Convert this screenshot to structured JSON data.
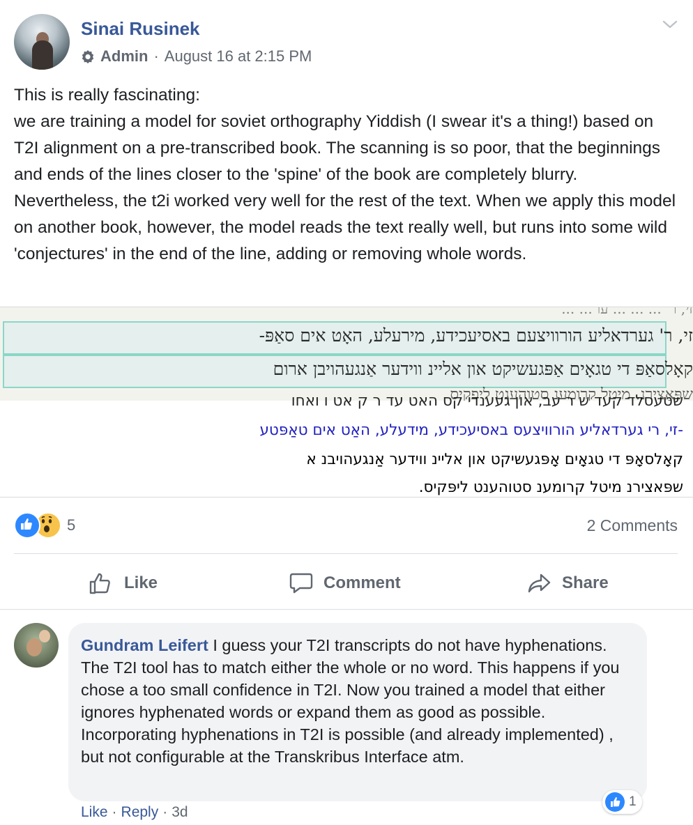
{
  "post": {
    "author": "Sinai Rusinek",
    "role": "Admin",
    "separator": "·",
    "timestamp": "August 16 at 2:15 PM",
    "text": "This is really fascinating:\nwe are training a model for soviet orthography Yiddish (I swear it's a thing!) based on T2I alignment on a pre-transcribed book. The scanning is so poor, that the beginnings and ends of the lines closer to the 'spine' of the book are completely blurry. Nevertheless, the t2i worked very well for the rest of the text. When we apply this model on another book, however, the model reads the text really well, but runs into some wild 'conjectures' in the end of the line, adding or removing whole words.",
    "icons": {
      "admin_badge": "admin-badge-icon",
      "menu": "chevron-down-icon"
    }
  },
  "scan": {
    "image_lines": [
      "זי, ר' גערדאליע הורוויצעם באסיעכידע, מירעלע, האָט אים סאַפּ-",
      "קאָלסאַפּ די טגאָים אַפּגעשיקט און אליינ ווידער אַנגעהויבן ארום",
      "שפּאַצירנ. מיטל קרומענ סטוהעגט ליפקיס"
    ],
    "transcription_lines": [
      "-זי, רי גערדאליע הורוויצעס באסיעכידע, מידעלע, האַט אים טאַפּטע",
      "קאָלסאָפּ די טגאָים אָפּגעשיקט און אליינ ווידער אַנגעהויבנ א",
      "שפּאצירנ מיטל קרומענ סטוהענט ליפּקיס."
    ]
  },
  "engagement": {
    "reaction_count": "5",
    "comments_label": "2 Comments",
    "reactions": [
      "like",
      "wow"
    ]
  },
  "actions": {
    "like": "Like",
    "comment": "Comment",
    "share": "Share"
  },
  "comment": {
    "author": "Gundram Leifert",
    "text": " I guess your T2I transcripts do not have hyphenations. The T2I tool has to match either the whole or no word. This happens if you chose a too small confidence in T2I. Now you trained a model that either ignores hyphenated words or expand them as good as possible. Incorporating hyphenations in T2I is possible (and already implemented) , but not configurable at the Transkribus Interface atm.",
    "reaction_count": "1",
    "like_link": "Like",
    "reply_link": "Reply",
    "age": "3d",
    "separator": "·"
  },
  "colors": {
    "link_blue": "#385898",
    "like_blue": "#2d88ff",
    "secondary_text": "#606770",
    "bubble_bg": "#f2f3f5"
  }
}
